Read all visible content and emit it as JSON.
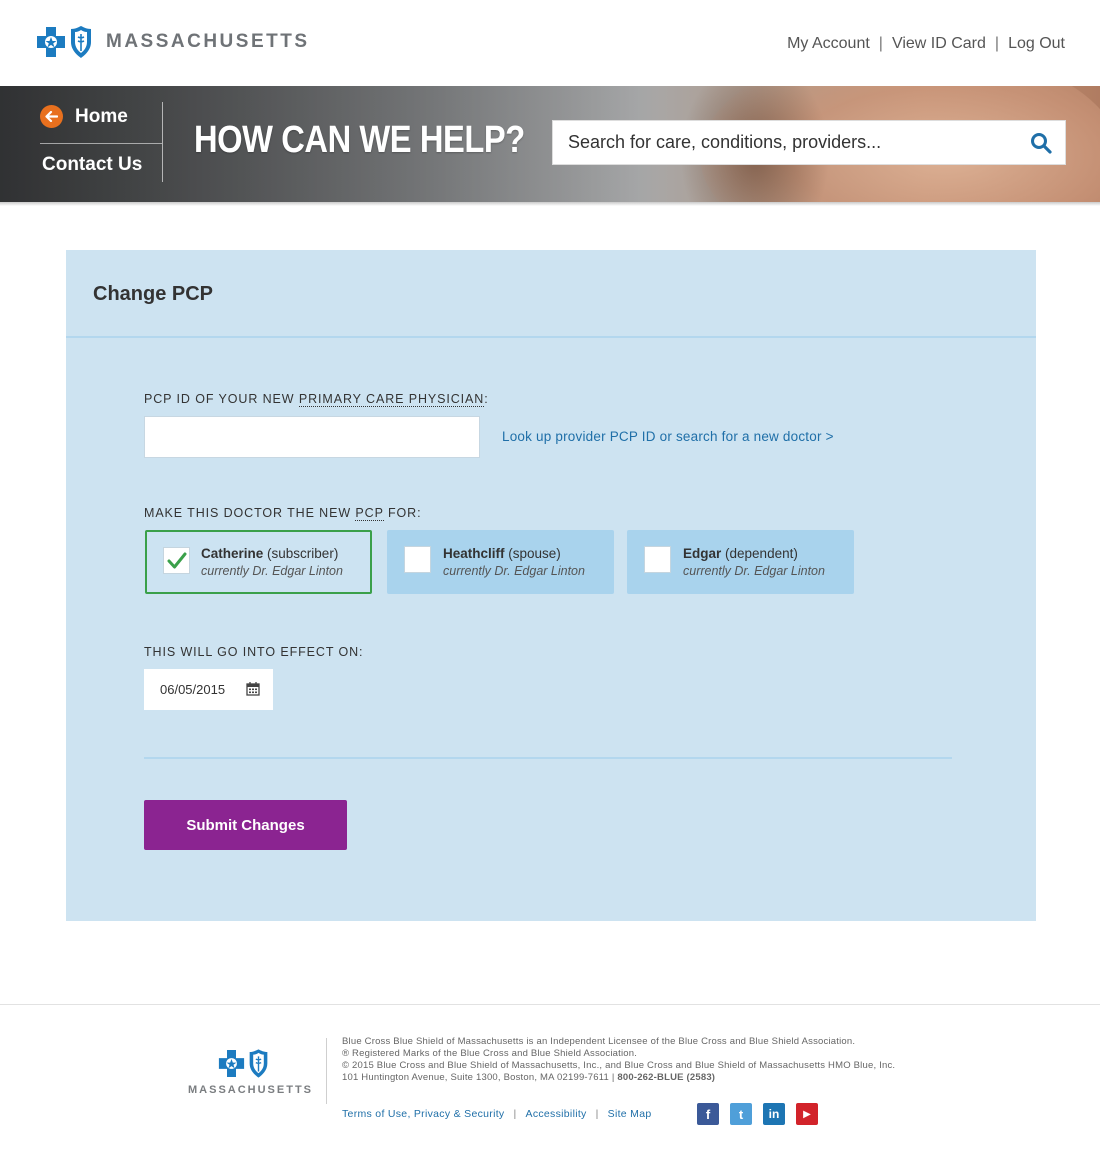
{
  "brand": {
    "wordmark": "MASSACHUSETTS"
  },
  "topnav": [
    {
      "label": "My Account"
    },
    {
      "label": "View ID Card"
    },
    {
      "label": "Log Out"
    }
  ],
  "topnav_separator": "|",
  "hero": {
    "home_label": "Home",
    "contact_label": "Contact Us",
    "title": "HOW CAN WE HELP?",
    "search_placeholder": "Search for care, conditions, providers..."
  },
  "form": {
    "title": "Change PCP",
    "pcp_label_prefix": "PCP ID OF YOUR NEW ",
    "pcp_label_abbr": "PRIMARY CARE PHYSICIAN",
    "pcp_label_suffix": ":",
    "pcp_value": "",
    "lookup_link": "Look up provider PCP ID or search for a new doctor >",
    "members_label_prefix": "MAKE THIS DOCTOR THE NEW ",
    "members_label_abbr": "PCP",
    "members_label_suffix": " FOR:",
    "members": [
      {
        "name": "Catherine",
        "role": "(subscriber)",
        "current": "currently Dr. Edgar Linton",
        "checked": true
      },
      {
        "name": "Heathcliff",
        "role": "(spouse)",
        "current": "currently Dr. Edgar Linton",
        "checked": false
      },
      {
        "name": "Edgar",
        "role": "(dependent)",
        "current": "currently Dr. Edgar Linton",
        "checked": false
      }
    ],
    "effective_label": "THIS WILL GO INTO EFFECT ON:",
    "effective_date": "06/05/2015",
    "submit_label": "Submit Changes"
  },
  "footer": {
    "wordmark": "MASSACHUSETTS",
    "lines": [
      "Blue Cross Blue Shield of Massachusetts is an Independent Licensee of the Blue Cross and Blue Shield Association.",
      "® Registered Marks of the Blue Cross and Blue Shield Association.",
      "© 2015 Blue Cross and Blue Shield of Massachusetts, Inc., and Blue Cross and Blue Shield of Massachusetts HMO Blue, Inc.",
      "101 Huntington Avenue, Suite 1300, Boston, MA 02199-7611 | "
    ],
    "phone": "800-262-BLUE (2583)",
    "links": [
      {
        "label": "Terms of Use, Privacy & Security"
      },
      {
        "label": "Accessibility"
      },
      {
        "label": "Site Map"
      }
    ],
    "link_separator": "|",
    "social": [
      {
        "icon": "facebook-icon",
        "glyph": "f",
        "color": "#3b5998"
      },
      {
        "icon": "twitter-icon",
        "glyph": "t",
        "color": "#4f9fd9"
      },
      {
        "icon": "linkedin-icon",
        "glyph": "in",
        "color": "#1d75b3"
      },
      {
        "icon": "youtube-icon",
        "glyph": "▶",
        "color": "#d2232a"
      }
    ]
  },
  "colors": {
    "brand_blue": "#1f6fa8",
    "panel_bg": "#cde3f1",
    "submit_purple": "#8b2491",
    "selected_border": "#3aa04a",
    "home_arrow_orange": "#e8701e"
  }
}
